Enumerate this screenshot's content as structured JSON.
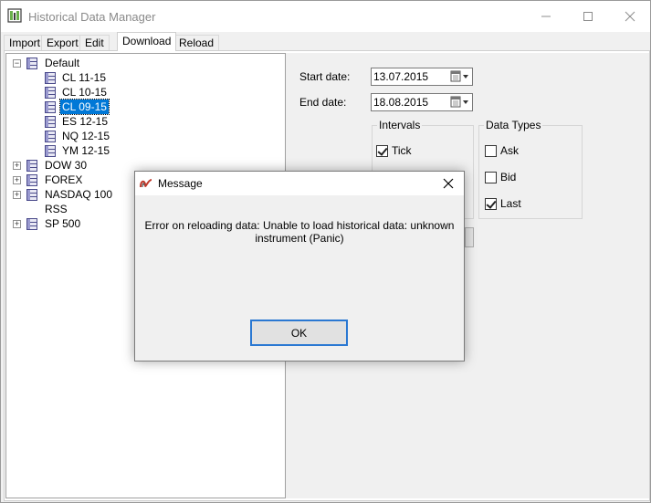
{
  "window": {
    "title": "Historical Data Manager"
  },
  "tabs": [
    {
      "label": "Import",
      "active": false
    },
    {
      "label": "Export",
      "active": false
    },
    {
      "label": "Edit",
      "active": false
    },
    {
      "label": "Download",
      "active": true
    },
    {
      "label": "Reload",
      "active": false
    }
  ],
  "tree": {
    "root": {
      "label": "Default",
      "expanded": true,
      "children": [
        "CL 11-15",
        "CL 10-15",
        "CL 09-15",
        "ES 12-15",
        "NQ 12-15",
        "YM 12-15"
      ],
      "selected": "CL 09-15"
    },
    "others": [
      {
        "label": "DOW 30",
        "expandable": true
      },
      {
        "label": "FOREX",
        "expandable": true
      },
      {
        "label": "NASDAQ 100",
        "expandable": true
      },
      {
        "label": "RSS",
        "expandable": false
      },
      {
        "label": "SP 500",
        "expandable": true
      }
    ]
  },
  "form": {
    "start_date_label": "Start date:",
    "start_date_value": "13.07.2015",
    "end_date_label": "End date:",
    "end_date_value": "18.08.2015",
    "intervals": {
      "title": "Intervals",
      "items": [
        {
          "label": "Tick",
          "checked": true
        }
      ]
    },
    "data_types": {
      "title": "Data Types",
      "items": [
        {
          "label": "Ask",
          "checked": false
        },
        {
          "label": "Bid",
          "checked": false
        },
        {
          "label": "Last",
          "checked": true
        }
      ]
    }
  },
  "dialog": {
    "title": "Message",
    "message_line1": "Error on reloading data: Unable to load historical data: unknown",
    "message_line2": "instrument (Panic)",
    "ok_label": "OK"
  },
  "colors": {
    "selection": "#0078d7",
    "focus_border": "#2a78d2"
  }
}
